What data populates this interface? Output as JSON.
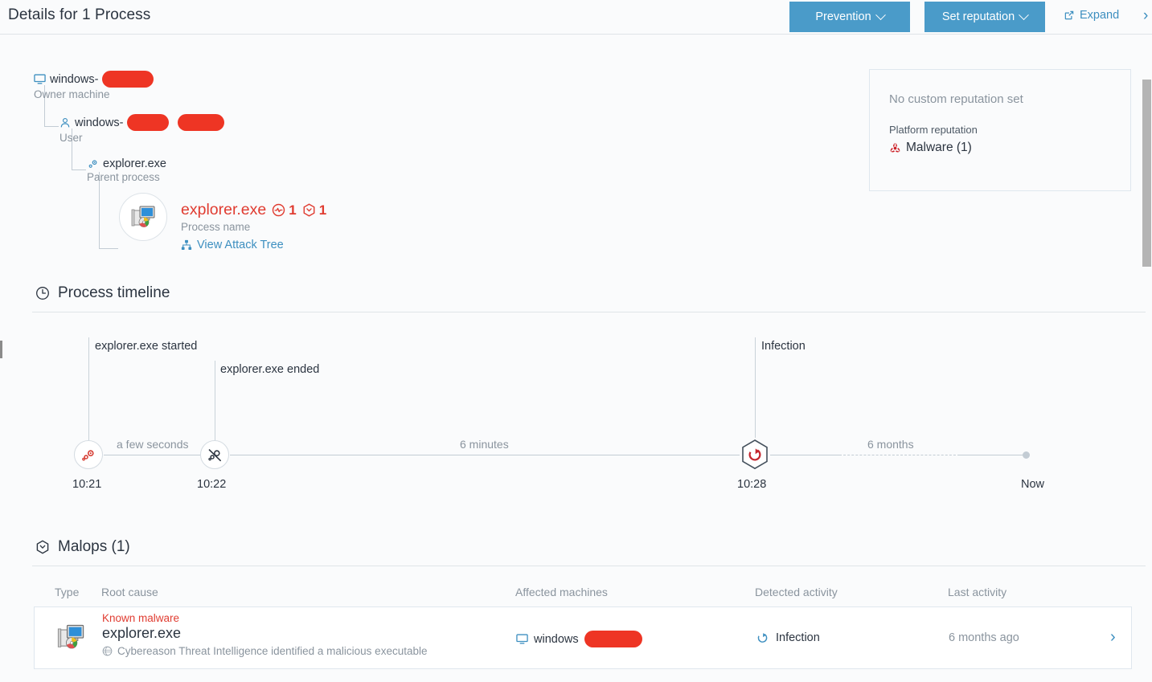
{
  "header": {
    "title": "Details for 1 Process",
    "prevention_label": "Prevention",
    "set_reputation_label": "Set reputation",
    "expand_label": "Expand"
  },
  "tree": {
    "machine": {
      "name": "windows-",
      "redacted": true,
      "sublabel": "Owner machine"
    },
    "user": {
      "name": "windows-",
      "redacted": true,
      "sublabel": "User"
    },
    "parent": {
      "name": "explorer.exe",
      "sublabel": "Parent process"
    },
    "process": {
      "name": "explorer.exe",
      "sublabel": "Process name",
      "detection_count": "1",
      "malop_count": "1",
      "attack_tree_label": "View Attack Tree"
    }
  },
  "reputation": {
    "no_custom": "No custom reputation set",
    "platform_label": "Platform reputation",
    "platform_value": "Malware (1)"
  },
  "timeline": {
    "heading": "Process timeline",
    "events": [
      {
        "label": "explorer.exe started",
        "time": "10:21",
        "icon": "gear-start-icon"
      },
      {
        "label": "explorer.exe ended",
        "time": "10:22",
        "icon": "gear-stop-icon"
      },
      {
        "label": "Infection",
        "time": "10:28",
        "icon": "infection-icon"
      }
    ],
    "durations": [
      "a few seconds",
      "6 minutes",
      "6 months"
    ],
    "end_label": "Now"
  },
  "malops": {
    "heading": "Malops (1)",
    "columns": [
      "Type",
      "Root cause",
      "Affected machines",
      "Detected activity",
      "Last activity"
    ],
    "rows": [
      {
        "type_icon": "windows-explorer-icon",
        "root_cause_category": "Known malware",
        "root_cause_name": "explorer.exe",
        "root_cause_desc": "Cybereason Threat Intelligence identified a malicious executable",
        "affected_machine": "windows",
        "detected_activity": "Infection",
        "last_activity": "6 months ago"
      }
    ]
  },
  "colors": {
    "accent_blue": "#4a9bc9",
    "link_blue": "#3d8fc0",
    "danger_red": "#e03c31",
    "redaction_red": "#ee3524",
    "muted": "#8a949e"
  }
}
